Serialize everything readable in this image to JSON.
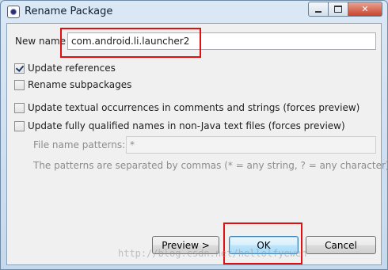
{
  "window": {
    "title": "Rename Package",
    "icon": "eclipse-icon",
    "controls": {
      "minimize": "minimize-icon",
      "maximize": "maximize-icon",
      "close": "✕"
    }
  },
  "form": {
    "new_name_label": "New name",
    "new_name_value": "com.android.li.launcher2",
    "update_references": {
      "label": "Update references",
      "checked": true
    },
    "rename_subpackages": {
      "label": "Rename subpackages",
      "checked": false
    },
    "update_textual": {
      "label": "Update textual occurrences in comments and strings (forces preview)",
      "checked": false
    },
    "update_qualified": {
      "label": "Update fully qualified names in non-Java text files (forces preview)",
      "checked": false
    },
    "file_patterns_label": "File name patterns:",
    "file_patterns_value": "*",
    "patterns_hint": "The patterns are separated by commas (* = any string, ? = any character)"
  },
  "buttons": {
    "preview": "Preview >",
    "ok": "OK",
    "cancel": "Cancel"
  },
  "watermark": "http://blog.csdn.net/hellolfyewen",
  "colors": {
    "highlight": "#e01010",
    "default_button": "#3c7fb1"
  }
}
